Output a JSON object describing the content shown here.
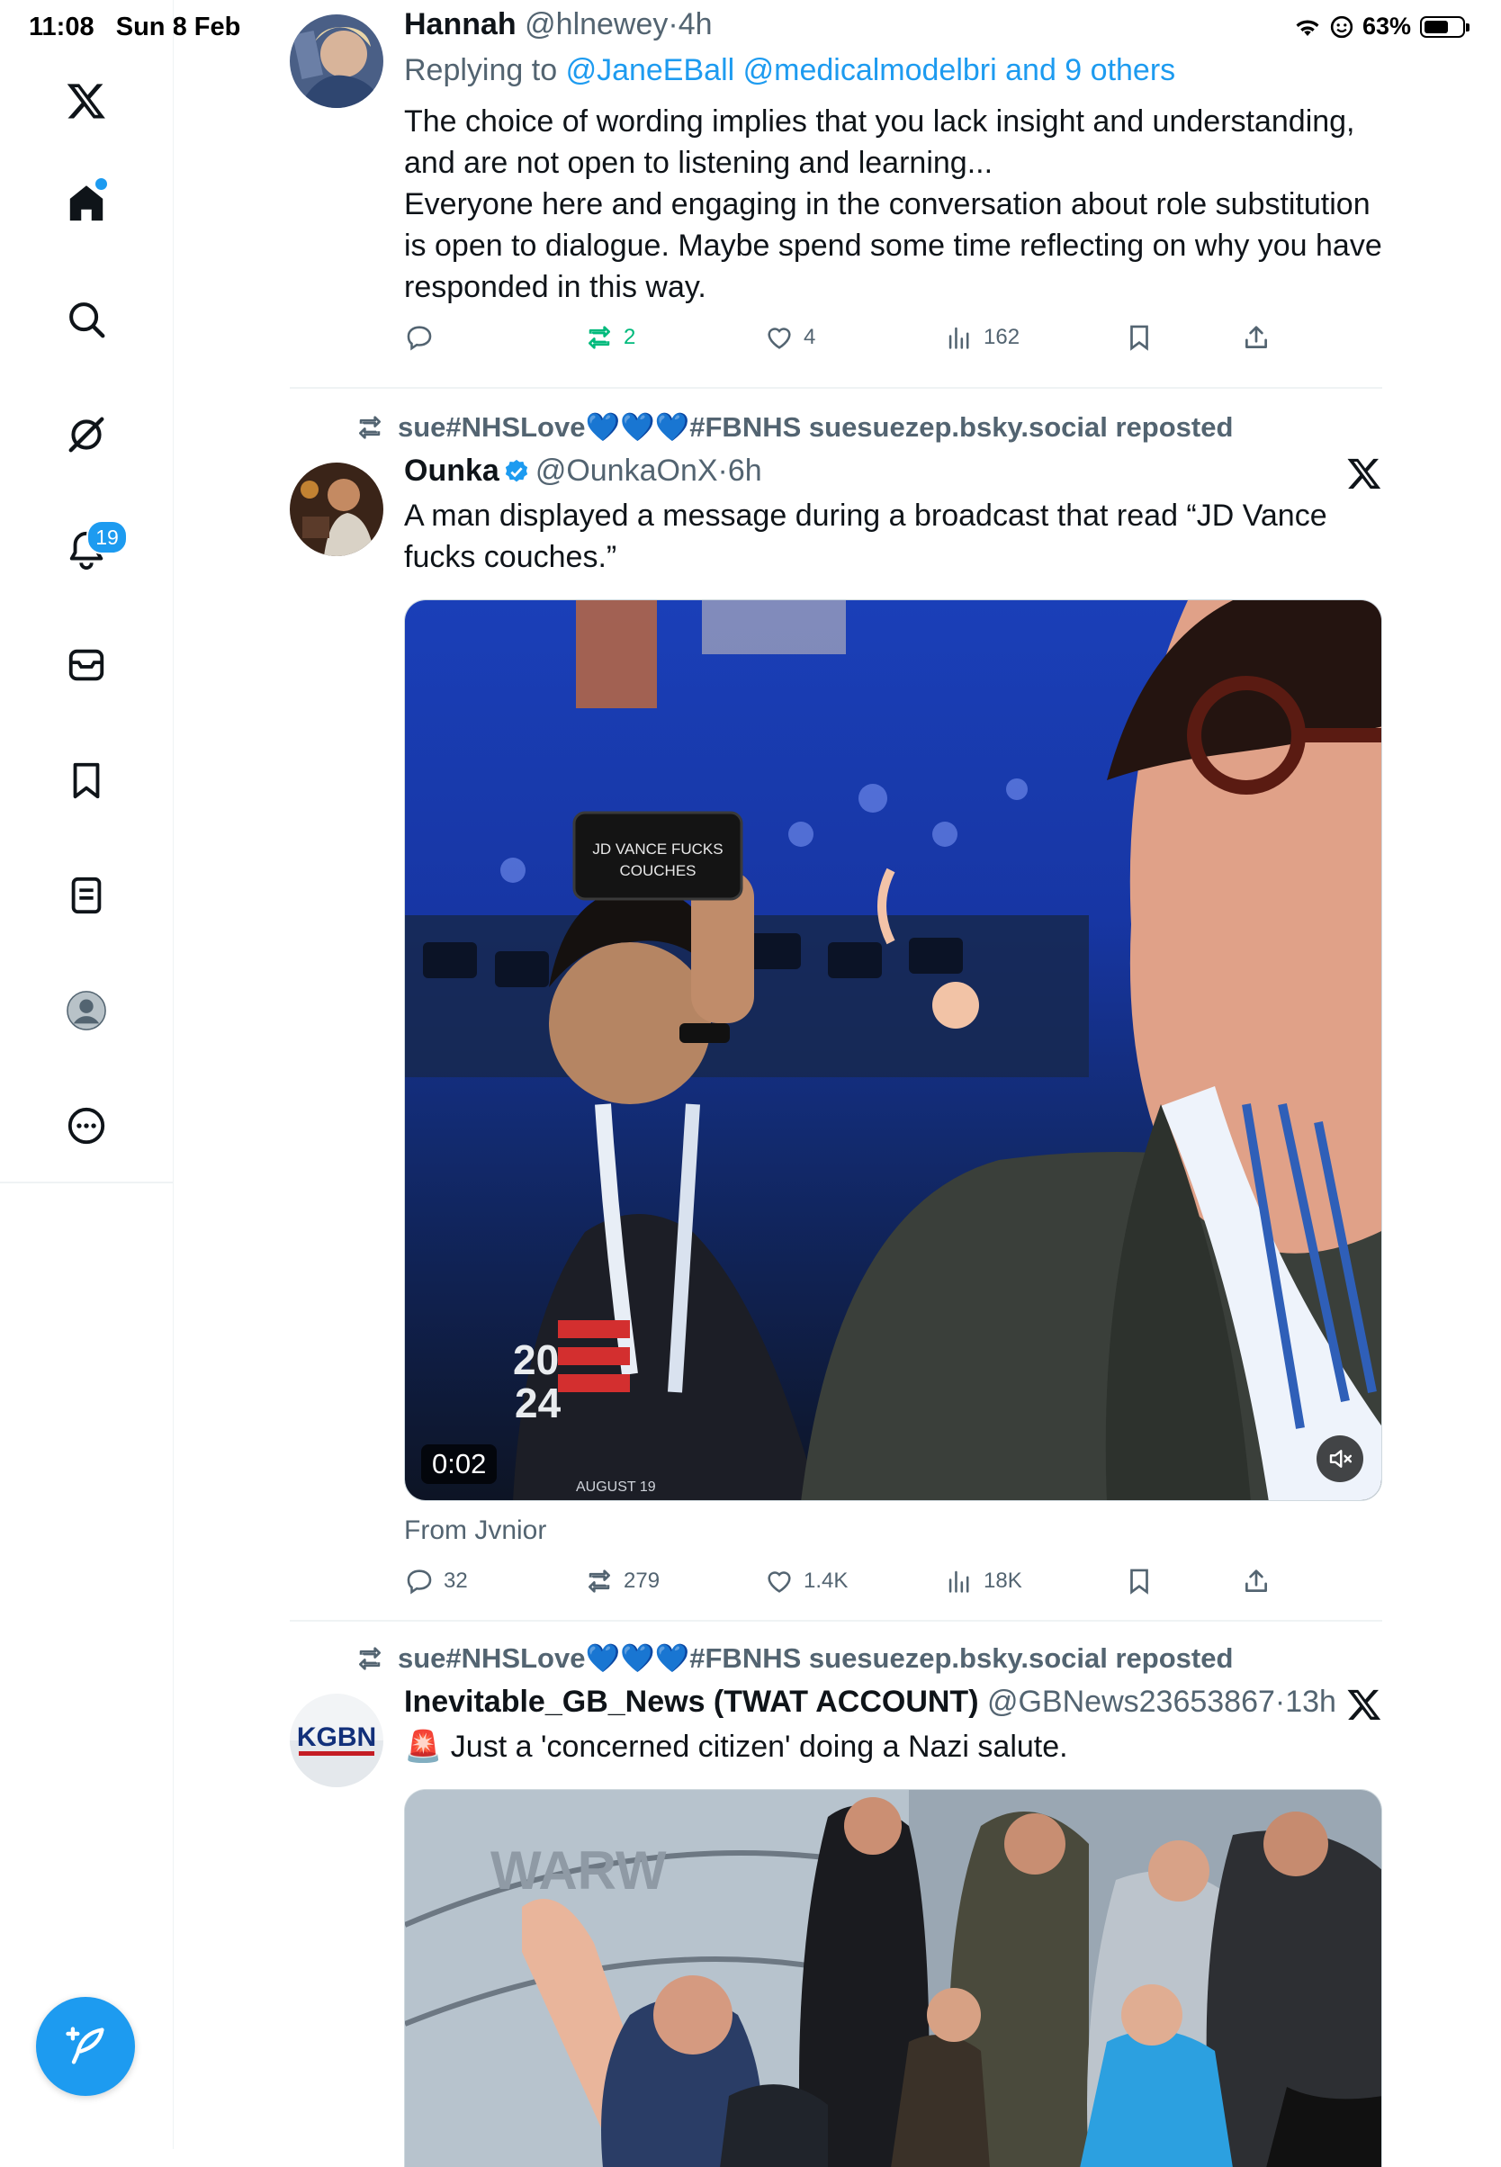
{
  "status_bar": {
    "time": "11:08",
    "date": "Sun 8 Feb",
    "battery": "63%",
    "battery_level": 0.63,
    "icons": [
      "wifi-icon",
      "focus-smile-icon",
      "battery-icon"
    ]
  },
  "sidebar": {
    "items": [
      {
        "icon": "x-logo-icon"
      },
      {
        "icon": "home-icon",
        "has_dot": true
      },
      {
        "icon": "search-icon"
      },
      {
        "icon": "grok-icon"
      },
      {
        "icon": "bell-icon",
        "badge": "19"
      },
      {
        "icon": "mail-icon"
      },
      {
        "icon": "bookmark-icon"
      },
      {
        "icon": "lists-icon"
      },
      {
        "icon": "profile-avatar"
      },
      {
        "icon": "more-circle-icon"
      }
    ],
    "compose_icon": "compose-feather-icon",
    "accent": "#1d9bf0"
  },
  "tweets": [
    {
      "name": "Hannah",
      "handle": "@hlnewey",
      "time": "4h",
      "replying_prefix": "Replying to",
      "replying_to": "@JaneEBall @medicalmodelbri and 9 others",
      "text_lines": [
        "The choice of wording implies that you lack insight and understanding,",
        "and are not open to listening and learning...",
        "Everyone here and engaging in the conversation about role substitution",
        "is open to dialogue. Maybe spend some time reflecting on why you have",
        "responded in this way."
      ],
      "actions": {
        "replies": "",
        "reposts": "2",
        "likes": "4",
        "views": "162"
      }
    },
    {
      "repost_by": "sue#NHSLove💙💙💙#FBNHS suesuezep.bsky.social reposted",
      "name": "Ounka",
      "verified": true,
      "handle": "@OunkaOnX",
      "time": "6h",
      "text_lines": [
        "A man displayed a message during a broadcast that read “JD Vance",
        "fucks couches.”"
      ],
      "media": {
        "video_time": "0:02",
        "sign_text_1": "JD VANCE FUCKS",
        "sign_text_2": "COUCHES",
        "shirt_text_1": "20",
        "shirt_text_2": "24"
      },
      "from": "From Jvnior",
      "actions": {
        "replies": "32",
        "reposts": "279",
        "likes": "1.4K",
        "views": "18K"
      }
    },
    {
      "repost_by": "sue#NHSLove💙💙💙#FBNHS suesuezep.bsky.social reposted",
      "name": "Inevitable_GB_News (TWAT ACCOUNT)",
      "handle": "@GBNews23653867",
      "time": "13h",
      "avatar_text": "KGBN",
      "text_prefix_emoji": "🚨",
      "text_lines": [
        "Just a 'concerned citizen' doing a Nazi salute."
      ],
      "media": {
        "sign_letters": "WARW"
      }
    }
  ]
}
